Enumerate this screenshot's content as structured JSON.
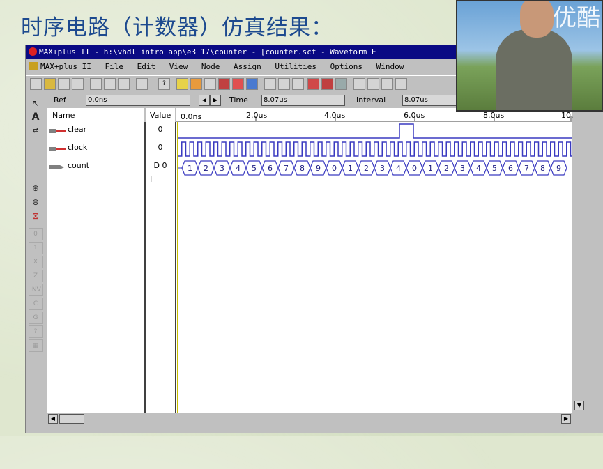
{
  "slide": {
    "title": "时序电路（计数器）仿真结果："
  },
  "window": {
    "title": "MAX+plus II - h:\\vhdl_intro_app\\e3_17\\counter - [counter.scf - Waveform E"
  },
  "menu": [
    "MAX+plus II",
    "File",
    "Edit",
    "View",
    "Node",
    "Assign",
    "Utilities",
    "Options",
    "Window"
  ],
  "toolbar": {
    "ref_label": "Ref",
    "ref_value": "0.0ns",
    "time_label": "Time",
    "time_value": "8.07us",
    "interval_label": "Interval",
    "interval_value": "8.07us"
  },
  "editor": {
    "name_header": "Name",
    "value_header": "Value",
    "cursor_time": "0.0ns",
    "time_ticks": [
      "2.0us",
      "4.0us",
      "6.0us",
      "8.0us",
      "10."
    ],
    "signals": [
      {
        "name": "clear",
        "value": "0"
      },
      {
        "name": "clock",
        "value": "0"
      },
      {
        "name": "count",
        "value": "D 0"
      }
    ],
    "count_values": [
      "1",
      "2",
      "3",
      "4",
      "5",
      "6",
      "7",
      "8",
      "9",
      "0",
      "1",
      "2",
      "3",
      "4",
      "0",
      "1",
      "2",
      "3",
      "4",
      "5",
      "6",
      "7",
      "8",
      "9"
    ]
  },
  "overlay": {
    "watermark": "优酷"
  },
  "colors": {
    "title_text": "#1d4a8f",
    "titlebar": "#0a0a84",
    "wave": "#3a3ac0",
    "cursor": "#c8c000"
  },
  "icons": {
    "palette": [
      "pointer-icon",
      "text-tool-icon",
      "node-icon",
      "zoom-in-icon",
      "zoom-out-icon",
      "fit-icon"
    ]
  }
}
